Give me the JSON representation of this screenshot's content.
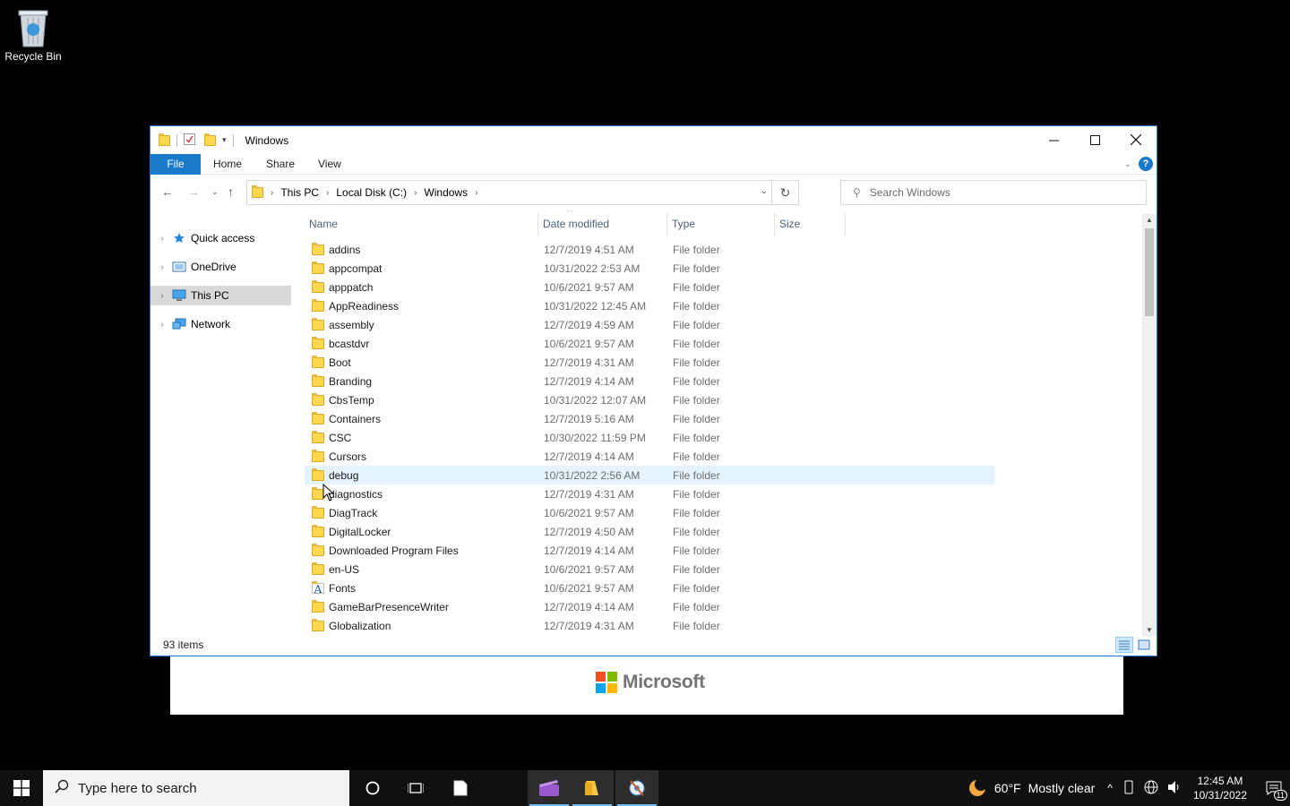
{
  "desktop": {
    "recycle_bin_label": "Recycle Bin",
    "bg_window_logo_text": "Microsoft"
  },
  "window": {
    "title": "Windows",
    "ribbon_tabs": [
      "File",
      "Home",
      "Share",
      "View"
    ],
    "address": {
      "crumbs": [
        "This PC",
        "Local Disk (C:)",
        "Windows"
      ]
    },
    "search_placeholder": "Search Windows",
    "nav_pane": [
      {
        "label": "Quick access",
        "icon": "star-icon",
        "selected": false
      },
      {
        "label": "OneDrive",
        "icon": "onedrive-icon",
        "selected": false
      },
      {
        "label": "This PC",
        "icon": "computer-icon",
        "selected": true
      },
      {
        "label": "Network",
        "icon": "network-icon",
        "selected": false
      }
    ],
    "columns": {
      "name": "Name",
      "date": "Date modified",
      "type": "Type",
      "size": "Size"
    },
    "files": [
      {
        "name": "addins",
        "date": "12/7/2019 4:51 AM",
        "type": "File folder"
      },
      {
        "name": "appcompat",
        "date": "10/31/2022 2:53 AM",
        "type": "File folder"
      },
      {
        "name": "apppatch",
        "date": "10/6/2021 9:57 AM",
        "type": "File folder"
      },
      {
        "name": "AppReadiness",
        "date": "10/31/2022 12:45 AM",
        "type": "File folder"
      },
      {
        "name": "assembly",
        "date": "12/7/2019 4:59 AM",
        "type": "File folder"
      },
      {
        "name": "bcastdvr",
        "date": "10/6/2021 9:57 AM",
        "type": "File folder"
      },
      {
        "name": "Boot",
        "date": "12/7/2019 4:31 AM",
        "type": "File folder"
      },
      {
        "name": "Branding",
        "date": "12/7/2019 4:14 AM",
        "type": "File folder"
      },
      {
        "name": "CbsTemp",
        "date": "10/31/2022 12:07 AM",
        "type": "File folder"
      },
      {
        "name": "Containers",
        "date": "12/7/2019 5:16 AM",
        "type": "File folder"
      },
      {
        "name": "CSC",
        "date": "10/30/2022 11:59 PM",
        "type": "File folder"
      },
      {
        "name": "Cursors",
        "date": "12/7/2019 4:14 AM",
        "type": "File folder"
      },
      {
        "name": "debug",
        "date": "10/31/2022 2:56 AM",
        "type": "File folder",
        "hover": true
      },
      {
        "name": "diagnostics",
        "date": "12/7/2019 4:31 AM",
        "type": "File folder"
      },
      {
        "name": "DiagTrack",
        "date": "10/6/2021 9:57 AM",
        "type": "File folder"
      },
      {
        "name": "DigitalLocker",
        "date": "12/7/2019 4:50 AM",
        "type": "File folder"
      },
      {
        "name": "Downloaded Program Files",
        "date": "12/7/2019 4:14 AM",
        "type": "File folder"
      },
      {
        "name": "en-US",
        "date": "10/6/2021 9:57 AM",
        "type": "File folder"
      },
      {
        "name": "Fonts",
        "date": "10/6/2021 9:57 AM",
        "type": "File folder",
        "icon": "fonts-folder-icon"
      },
      {
        "name": "GameBarPresenceWriter",
        "date": "12/7/2019 4:14 AM",
        "type": "File folder"
      },
      {
        "name": "Globalization",
        "date": "12/7/2019 4:31 AM",
        "type": "File folder"
      }
    ],
    "status_text": "93 items"
  },
  "taskbar": {
    "search_placeholder": "Type here to search",
    "weather_temp": "60°F",
    "weather_text": "Mostly clear",
    "time": "12:45 AM",
    "date": "10/31/2022",
    "notification_count": "11"
  },
  "colors": {
    "accent": "#1979ca",
    "folder": "#ffd84d",
    "hover_row": "#e5f3ff",
    "selected_nav": "#d9d9d9"
  }
}
